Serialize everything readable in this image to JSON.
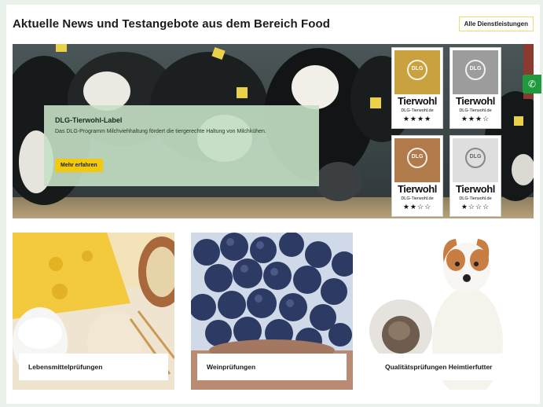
{
  "header": {
    "title": "Aktuelle News und Testangebote aus dem Bereich Food",
    "all_services_label": "Alle Dienstleistungen"
  },
  "hero": {
    "title": "DLG-Tierwohl-Label",
    "text": "Das DLG-Programm Milchviehhaltung fördert die tiergerechte Haltung von Milchkühen.",
    "cta_label": "Mehr erfahren",
    "phone_icon": "phone-icon"
  },
  "badges": [
    {
      "label": "Tierwohl",
      "site": "DLG-Tierwohl.de",
      "logo": "DLG",
      "stars": "★★★★",
      "color": "#c9a23f"
    },
    {
      "label": "Tierwohl",
      "site": "DLG-Tierwohl.de",
      "logo": "DLG",
      "stars": "★★★☆",
      "color": "#9c9c9c"
    },
    {
      "label": "Tierwohl",
      "site": "DLG-Tierwohl.de",
      "logo": "DLG",
      "stars": "★★☆☆",
      "color": "#b07a4b"
    },
    {
      "label": "Tierwohl",
      "site": "DLG-Tierwohl.de",
      "logo": "DLG",
      "stars": "★☆☆☆",
      "color": "#dedede"
    }
  ],
  "cards": [
    {
      "label": "Lebensmittelprüfungen"
    },
    {
      "label": "Weinprüfungen"
    },
    {
      "label": "Qualitätsprüfungen Heimtierfutter"
    }
  ],
  "colors": {
    "accent_yellow": "#f3c90f",
    "green": "#1f9b3d",
    "background": "#e9f1ea"
  }
}
